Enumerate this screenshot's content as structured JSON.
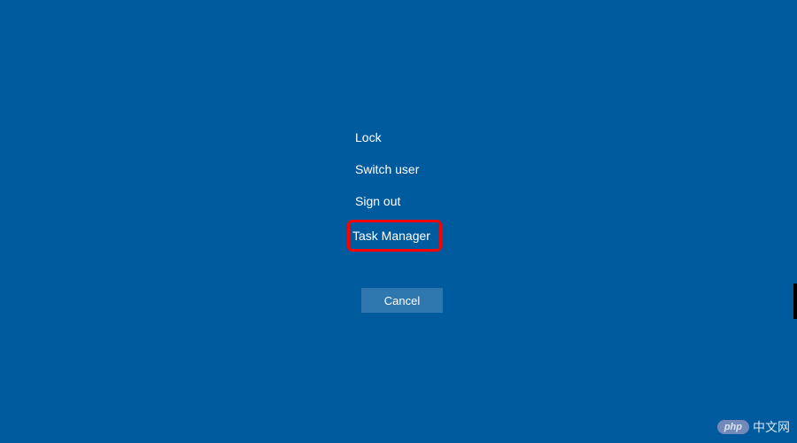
{
  "options": {
    "lock": "Lock",
    "switch_user": "Switch user",
    "sign_out": "Sign out",
    "task_manager": "Task Manager"
  },
  "cancel_label": "Cancel",
  "watermark": {
    "badge": "php",
    "text": "中文网"
  },
  "colors": {
    "background": "#005a9e",
    "highlight_border": "#ff0000",
    "text": "#ffffff"
  }
}
